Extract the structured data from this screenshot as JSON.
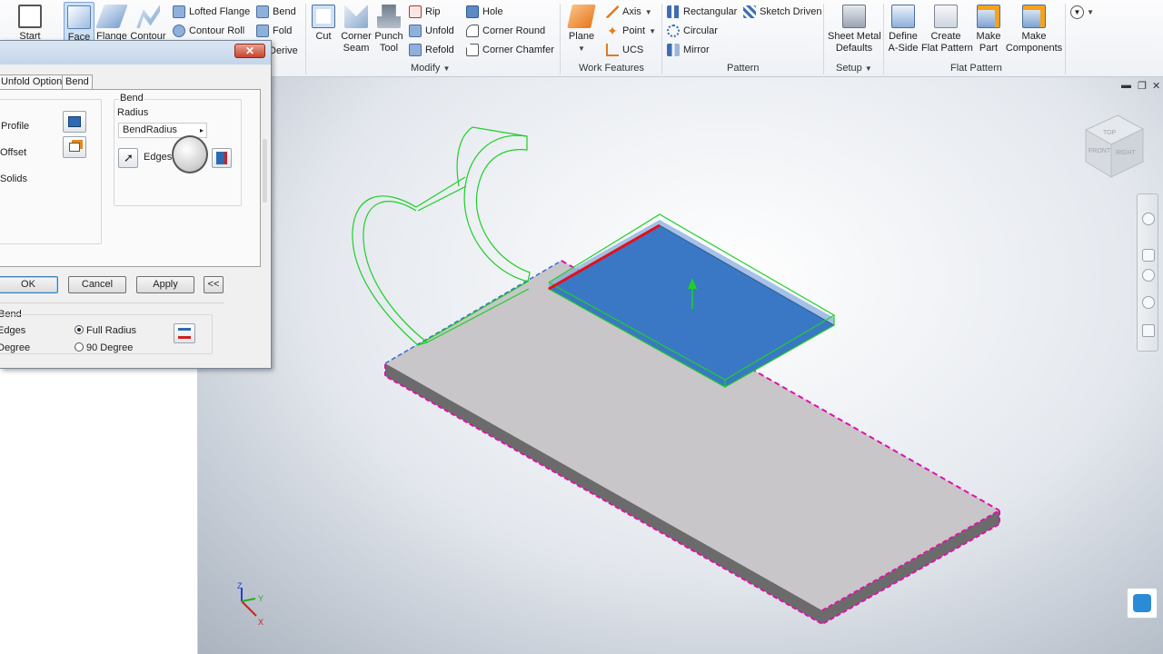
{
  "ribbon": {
    "create": {
      "start": "Start",
      "face": "Face",
      "flange": "Flange",
      "contour": "Contour",
      "lofted_flange": "Lofted Flange",
      "contour_roll": "Contour Roll",
      "bend": "Bend",
      "fold": "Fold",
      "derive": "Derive"
    },
    "modify": {
      "cut": "Cut",
      "corner_seam_1": "Corner",
      "corner_seam_2": "Seam",
      "punch_tool_1": "Punch",
      "punch_tool_2": "Tool",
      "rip": "Rip",
      "unfold": "Unfold",
      "refold": "Refold",
      "hole": "Hole",
      "corner_round": "Corner Round",
      "corner_chamfer": "Corner Chamfer",
      "group_label": "Modify"
    },
    "work_features": {
      "plane": "Plane",
      "axis": "Axis",
      "point": "Point",
      "ucs": "UCS",
      "group_label": "Work Features"
    },
    "pattern": {
      "rectangular": "Rectangular",
      "sketch_driven": "Sketch Driven",
      "circular": "Circular",
      "mirror": "Mirror",
      "group_label": "Pattern"
    },
    "setup": {
      "sheet_metal_defaults_1": "Sheet Metal",
      "sheet_metal_defaults_2": "Defaults",
      "group_label": "Setup"
    },
    "flat_pattern": {
      "define_aside_1": "Define",
      "define_aside_2": "A-Side",
      "create_flat_1": "Create",
      "create_flat_2": "Flat Pattern",
      "make_part_1": "Make",
      "make_part_2": "Part",
      "make_components_1": "Make",
      "make_components_2": "Components",
      "group_label": "Flat Pattern"
    }
  },
  "dialog": {
    "tabs": [
      "Unfold Options",
      "Bend"
    ],
    "profile": "Profile",
    "offset": "Offset",
    "solids": "Solids",
    "bend_group": "Bend",
    "radius_label": "Radius",
    "radius_value": "BendRadius",
    "edges": "Edges",
    "ok": "OK",
    "cancel": "Cancel",
    "apply": "Apply",
    "collapse": "<<",
    "bend_section": "Bend",
    "edges_opt": "Edges",
    "degree_opt": "Degree",
    "full_radius": "Full Radius",
    "ninety_degree": "90 Degree"
  },
  "viewcube": {
    "top": "TOP",
    "front": "FRONT",
    "right": "RIGHT"
  },
  "triad": {
    "z": "Z",
    "y": "Y",
    "x": "X"
  },
  "colors": {
    "accent_blue": "#2f6fc0",
    "face_blue": "#3a78c5",
    "highlight_red": "#e3101a",
    "preview_green": "#1ed028",
    "edge_magenta": "#e011a8"
  }
}
